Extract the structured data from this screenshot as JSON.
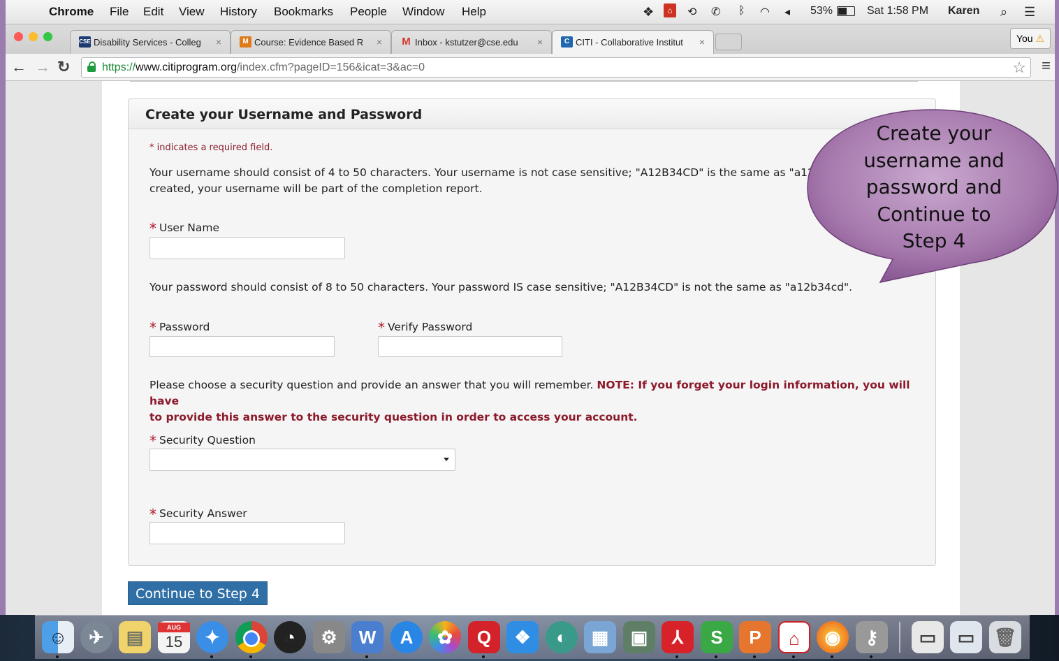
{
  "menubar": {
    "app": "Chrome",
    "items": [
      "File",
      "Edit",
      "View",
      "History",
      "Bookmarks",
      "People",
      "Window",
      "Help"
    ],
    "battery": "53%",
    "clock": "Sat 1:58 PM",
    "user": "Karen"
  },
  "browser": {
    "tabs": [
      {
        "favicon_text": "CSE",
        "title": "Disability Services - Colleg",
        "favicon_color": "#1b3a70"
      },
      {
        "favicon_text": "M",
        "title": "Course: Evidence Based R",
        "favicon_color": "#e07b1a"
      },
      {
        "favicon_text": "M",
        "title": "Inbox - kstutzer@cse.edu",
        "favicon_color": "#d23b2b"
      },
      {
        "favicon_text": "C",
        "title": "CITI - Collaborative Institut",
        "favicon_color": "#2167b0"
      }
    ],
    "profile_label": "You",
    "url_scheme": "https://",
    "url_host": "www.citiprogram.org",
    "url_path": "/index.cfm?pageID=156&icat=3&ac=0"
  },
  "form": {
    "title": "Create your Username and Password",
    "required_note": "* indicates a required field.",
    "username_help_line1": "Your username should consist of 4 to 50 characters. Your username is not case sensitive; \"A12B34CD\" is the same as \"a12b",
    "username_help_line2": "created, your username will be part of the completion report.",
    "username_label": "User Name",
    "username_value": "",
    "password_help": "Your password should consist of 8 to 50 characters. Your password IS case sensitive; \"A12B34CD\" is not the same as \"a12b34cd\".",
    "password_label": "Password",
    "password_value": "",
    "verify_label": "Verify Password",
    "verify_value": "",
    "security_help": "Please choose a security question and provide an answer that you will remember.",
    "security_note_line1": "NOTE: If you forget your login information, you will have",
    "security_note_line2": "to provide this answer to the security question in order to access your account.",
    "question_label": "Security Question",
    "question_value": "",
    "answer_label": "Security Answer",
    "answer_value": "",
    "asterisk": "*",
    "continue_button": "Continue to Step 4"
  },
  "callout": {
    "lines": [
      "Create your",
      "username and",
      "password and",
      "Continue to",
      "Step 4"
    ],
    "fill": "#a77aae"
  },
  "dock": {
    "calendar_month": "AUG",
    "calendar_day": "15"
  }
}
